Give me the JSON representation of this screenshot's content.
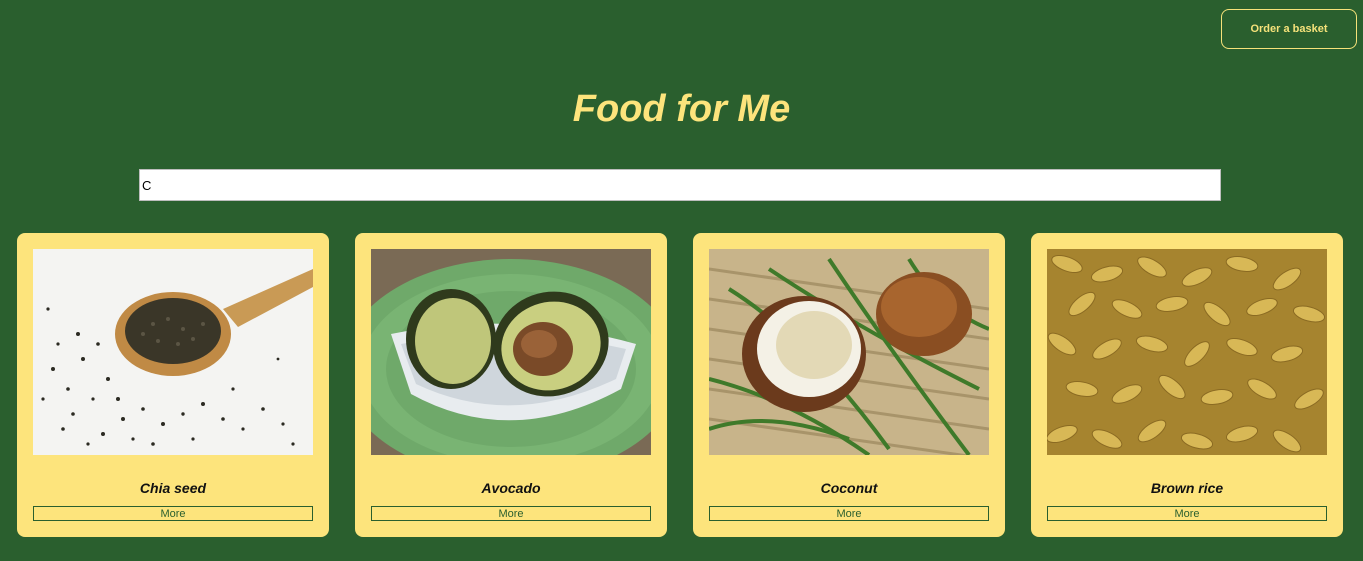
{
  "header": {
    "order_button": "Order a basket",
    "title": "Food for Me"
  },
  "search": {
    "value": "C"
  },
  "colors": {
    "background": "#2a5f2e",
    "accent": "#fde47c"
  },
  "cards": [
    {
      "name": "Chia seed",
      "image": "chia-seed-photo",
      "more": "More"
    },
    {
      "name": "Avocado",
      "image": "avocado-photo",
      "more": "More"
    },
    {
      "name": "Coconut",
      "image": "coconut-photo",
      "more": "More"
    },
    {
      "name": "Brown rice",
      "image": "brown-rice-photo",
      "more": "More"
    }
  ]
}
